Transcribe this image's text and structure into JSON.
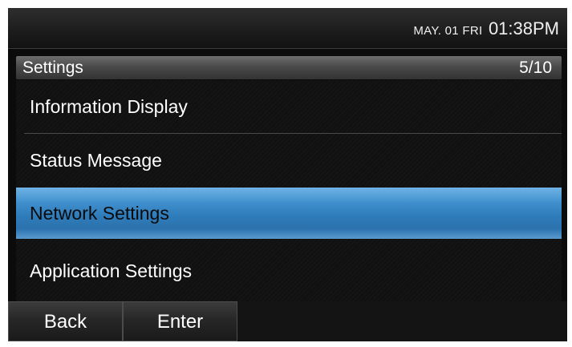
{
  "status_bar": {
    "date": "MAY. 01 FRI",
    "time": "01:38PM"
  },
  "header": {
    "title": "Settings",
    "page_indicator": "5/10"
  },
  "menu": {
    "items": [
      {
        "label": "Information Display",
        "selected": false
      },
      {
        "label": "Status Message",
        "selected": false
      },
      {
        "label": "Network Settings",
        "selected": true
      },
      {
        "label": "Application Settings",
        "selected": false
      }
    ],
    "selected_color": "#3f8fcc"
  },
  "softkeys": [
    {
      "label": "Back"
    },
    {
      "label": "Enter"
    }
  ]
}
